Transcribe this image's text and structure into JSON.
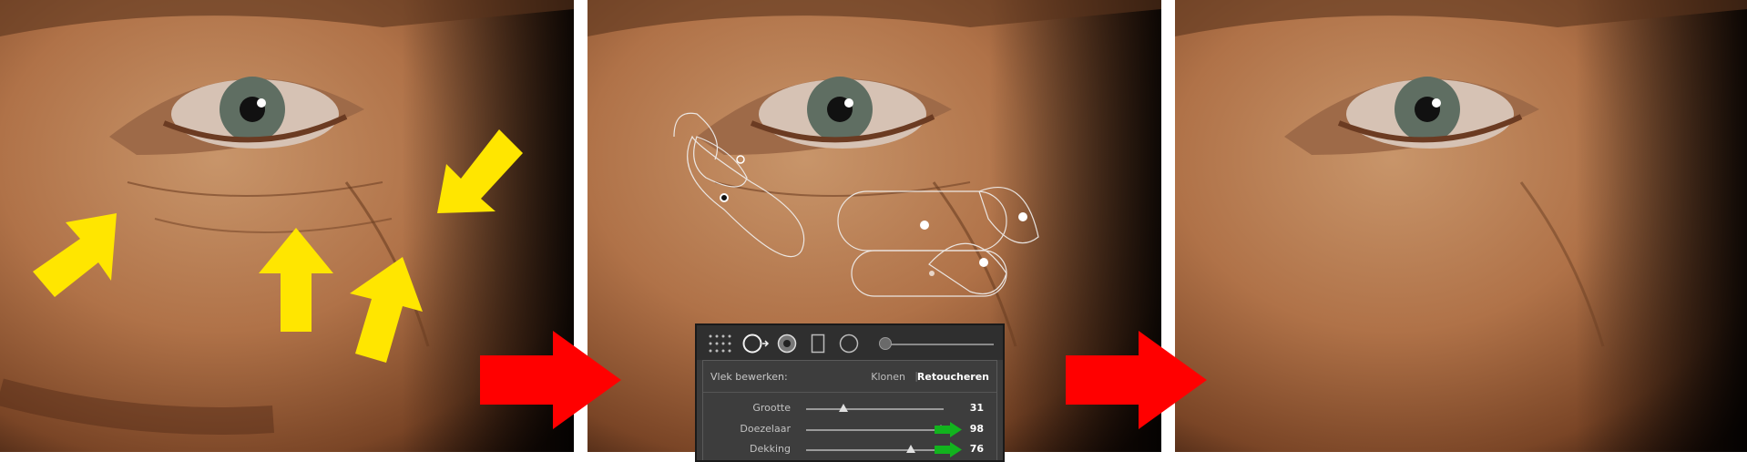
{
  "colors": {
    "arrow_yellow": "#ffe600",
    "arrow_red": "#ff0000",
    "arrow_green": "#12b31e",
    "panel_bg": "#3b3b3b"
  },
  "icons": [
    "grid-dots-icon",
    "spot-tool-icon",
    "heal-brush-icon",
    "rectangle-mask-icon",
    "circle-mask-icon",
    "size-slider-icon"
  ],
  "spot_panel": {
    "edit_label": "Vlek bewerken:",
    "mode_clone": "Klonen",
    "mode_separator": "|",
    "mode_heal": "Retoucheren",
    "sliders": [
      {
        "label": "Grootte",
        "value": "31",
        "position": 0.27
      },
      {
        "label": "Doezelaar",
        "value": "98",
        "position": 0.98
      },
      {
        "label": "Dekking",
        "value": "76",
        "position": 0.76
      }
    ]
  }
}
